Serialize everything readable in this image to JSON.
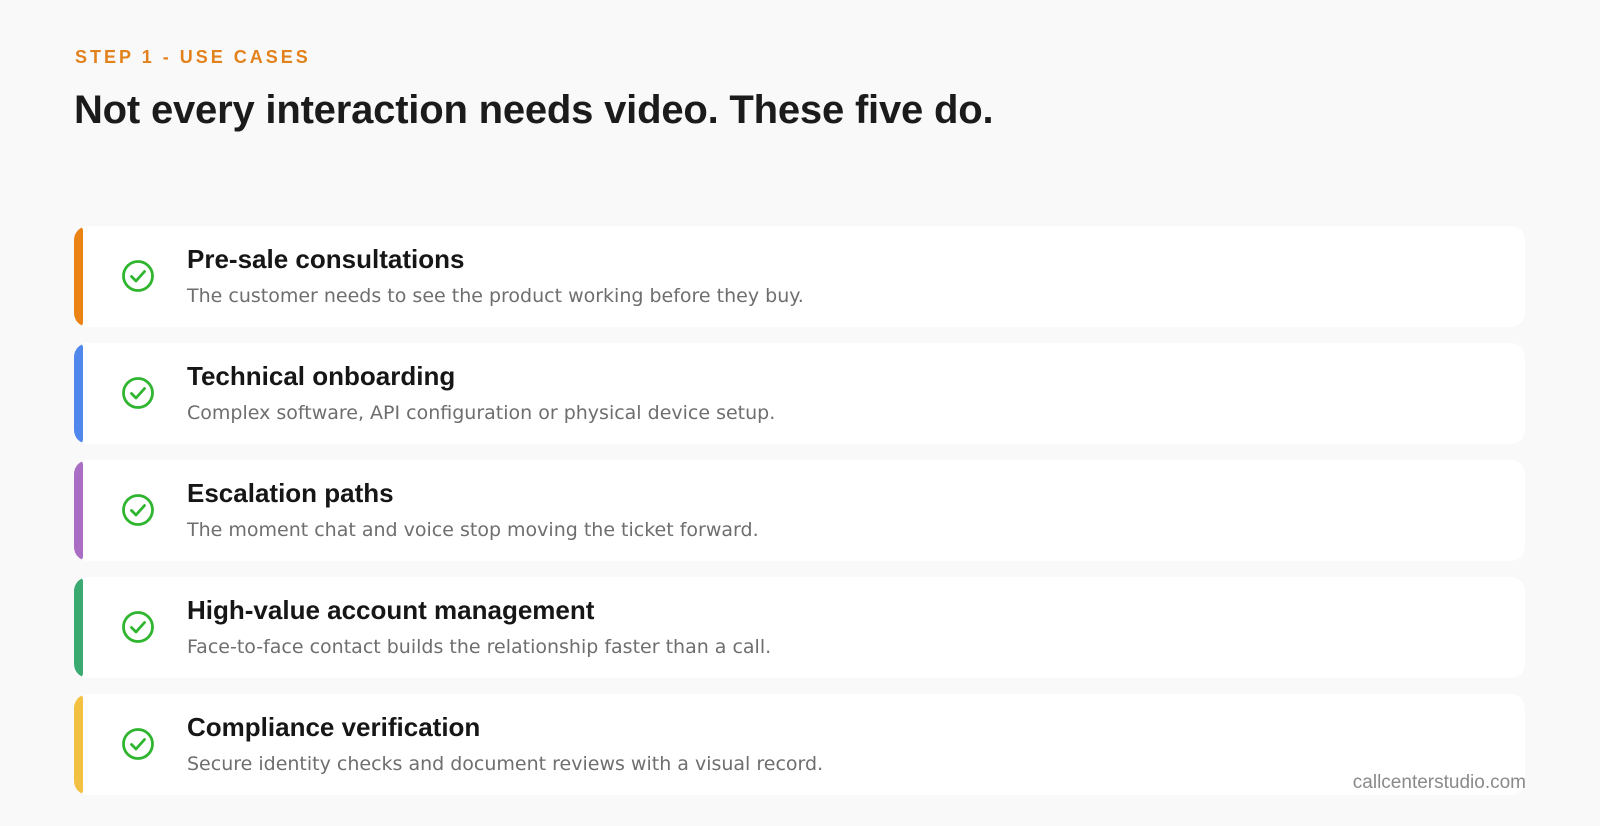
{
  "header": {
    "eyebrow": "STEP 1 - USE CASES",
    "headline": "Not every interaction needs video. These five do."
  },
  "use_cases": [
    {
      "title": "Pre-sale consultations",
      "description": "The customer needs to see the product working before they buy.",
      "accent_color": "#ea8214",
      "icon": "check-circle-icon"
    },
    {
      "title": "Technical onboarding",
      "description": "Complex software, API configuration or physical device setup.",
      "accent_color": "#5087ec",
      "icon": "check-circle-icon"
    },
    {
      "title": "Escalation paths",
      "description": "The moment chat and voice stop moving the ticket forward.",
      "accent_color": "#a96ec4",
      "icon": "check-circle-icon"
    },
    {
      "title": "High-value account management",
      "description": "Face-to-face contact builds the relationship faster than a call.",
      "accent_color": "#3aaa70",
      "icon": "check-circle-icon"
    },
    {
      "title": "Compliance verification",
      "description": "Secure identity checks and document reviews with a visual record.",
      "accent_color": "#f3c142",
      "icon": "check-circle-icon"
    }
  ],
  "check_color": "#2fb52f",
  "footer": {
    "brand": "callcenterstudio.com"
  }
}
